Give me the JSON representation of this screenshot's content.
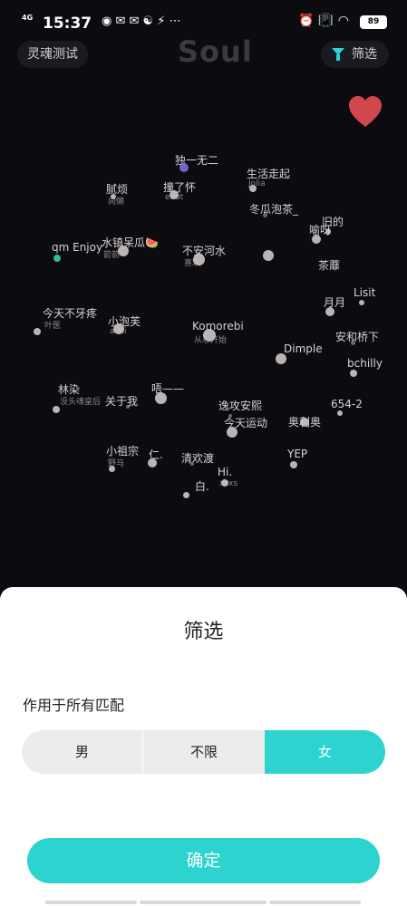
{
  "status": {
    "time": "15:37",
    "network": "4G",
    "battery": "89"
  },
  "header": {
    "left_pill": "灵魂测试",
    "logo": "Soul",
    "filter_label": "筛选"
  },
  "planets": [
    {
      "label": "独一无二",
      "sub": "",
      "sub2": "",
      "color": "#7a6fe0"
    },
    {
      "label": "撞了怀",
      "sub": "eaut",
      "sub2": "",
      "color": "#cfc6c6"
    },
    {
      "label": "生活走起",
      "sub": "Jolia",
      "sub2": "",
      "color": "#cfc6c6"
    },
    {
      "label": "腻烦",
      "sub": "向懒",
      "sub2": "",
      "color": "#cfc6c6"
    },
    {
      "label": "冬瓜泡茶_",
      "sub": "",
      "sub2": "",
      "color": "#cfc6c6"
    },
    {
      "label": "旧的",
      "sub": "",
      "sub2": "",
      "color": "#cfc6c6"
    },
    {
      "label": "喻呀",
      "sub": "",
      "sub2": "",
      "color": "#cfc6c6"
    },
    {
      "label": "qm Enjoy",
      "sub": "",
      "sub2": "",
      "color": "#3ecf9a"
    },
    {
      "label": "水镇呆瓜🍉",
      "sub": "箭箭",
      "sub2": "",
      "color": "#cfc6c6"
    },
    {
      "label": "不安河水",
      "sub": "喜欢",
      "sub2": "",
      "color": "#cfc6c6"
    },
    {
      "label": "茶蘼",
      "sub": "",
      "sub2": "",
      "color": "#cfc6c6"
    },
    {
      "label": "月月",
      "sub": "",
      "sub2": "",
      "color": "#cfc6c6"
    },
    {
      "label": "Lisit",
      "sub": "",
      "sub2": "",
      "color": "#cfc6c6"
    },
    {
      "label": "今天不牙疼",
      "sub": "叶医",
      "sub2": "",
      "color": "#cfc6c6"
    },
    {
      "label": "小泡芙",
      "sub": "a Mi",
      "sub2": "",
      "color": "#cfc6c6"
    },
    {
      "label": "Komorebi",
      "sub": "从心开始",
      "sub2": "",
      "color": "#cfc6c6"
    },
    {
      "label": "安和桥下",
      "sub": "",
      "sub2": "",
      "color": "#cfc6c6"
    },
    {
      "label": "Dimple",
      "sub": "",
      "sub2": "",
      "color": "#cfc6c6"
    },
    {
      "label": "bchilly",
      "sub": "",
      "sub2": "",
      "color": "#cfc6c6"
    },
    {
      "label": "林染",
      "sub": "没头魂皇后",
      "sub2": "",
      "color": "#cfc6c6"
    },
    {
      "label": "关于我",
      "sub": "",
      "sub2": "",
      "color": "#cfc6c6"
    },
    {
      "label": "唔——",
      "sub": "",
      "sub2": "",
      "color": "#cfc6c6"
    },
    {
      "label": "逸攻安熙",
      "sub": "",
      "sub2": "",
      "color": "#cfc6c6"
    },
    {
      "label": "654-2",
      "sub": "",
      "sub2": "",
      "color": "#cfc6c6"
    },
    {
      "label": "今天运动",
      "sub": "",
      "sub2": "",
      "color": "#cfc6c6"
    },
    {
      "label": "奥利奥",
      "sub": "",
      "sub2": "",
      "color": "#cfc6c6"
    },
    {
      "label": "小祖宗",
      "sub": "野马",
      "sub2": "",
      "color": "#cfc6c6"
    },
    {
      "label": "仁.",
      "sub": "",
      "sub2": "",
      "color": "#cfc6c6"
    },
    {
      "label": "清欢渡",
      "sub": "",
      "sub2": "",
      "color": "#cfc6c6"
    },
    {
      "label": "YEP",
      "sub": "",
      "sub2": "",
      "color": "#cfc6c6"
    },
    {
      "label": "Hi.",
      "sub": "xsxs",
      "sub2": "",
      "color": "#cfc6c6"
    },
    {
      "label": "白.",
      "sub": "",
      "sub2": "",
      "color": "#cfc6c6"
    }
  ],
  "sheet": {
    "title": "筛选",
    "scope_label": "作用于所有匹配",
    "options": [
      "男",
      "不限",
      "女"
    ],
    "selected": "女",
    "confirm_label": "确定"
  },
  "colors": {
    "accent": "#2cd3cf",
    "heart": "#d0474c"
  }
}
